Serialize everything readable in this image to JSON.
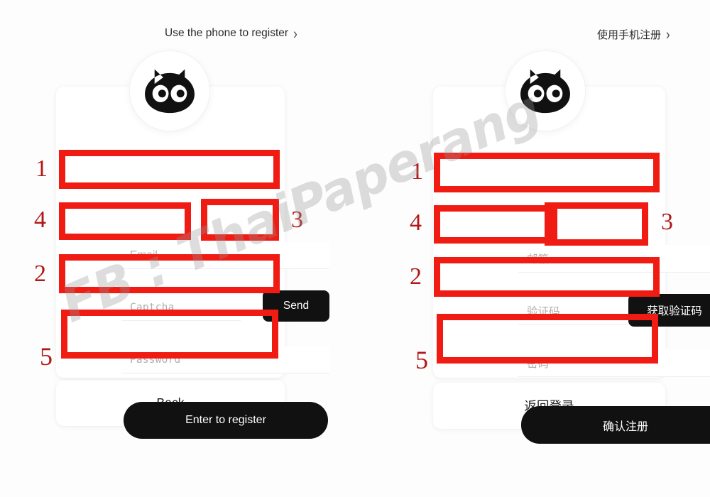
{
  "watermark": {
    "text": "FB : ThaiPaperang"
  },
  "panels": [
    {
      "id": "english",
      "top_link": {
        "label": "Use the phone to register",
        "chevron": "chevron-right-icon",
        "chevron_glyph": "›"
      },
      "logo": {
        "name": "cat-logo-icon"
      },
      "fields": {
        "email_placeholder": "Email",
        "captcha_placeholder": "Captcha",
        "password_placeholder": "Password"
      },
      "buttons": {
        "send_label": "Send",
        "submit_label": "Enter to register",
        "back_label": "Back"
      },
      "annotations": [
        {
          "number": "1",
          "target": "email-field"
        },
        {
          "number": "4",
          "target": "captcha-field"
        },
        {
          "number": "3",
          "target": "send-code-button"
        },
        {
          "number": "2",
          "target": "password-field"
        },
        {
          "number": "5",
          "target": "register-submit-button"
        }
      ]
    },
    {
      "id": "chinese",
      "top_link": {
        "label": "使用手机注册",
        "chevron": "chevron-right-icon",
        "chevron_glyph": "›"
      },
      "logo": {
        "name": "cat-logo-icon"
      },
      "fields": {
        "email_placeholder": "邮箱",
        "captcha_placeholder": "验证码",
        "password_placeholder": "密码"
      },
      "buttons": {
        "send_label": "获取验证码",
        "submit_label": "确认注册",
        "back_label": "返回登录"
      },
      "annotations": [
        {
          "number": "1",
          "target": "email-field"
        },
        {
          "number": "4",
          "target": "captcha-field"
        },
        {
          "number": "3",
          "target": "send-code-button"
        },
        {
          "number": "2",
          "target": "password-field"
        },
        {
          "number": "5",
          "target": "register-submit-button"
        }
      ]
    }
  ],
  "colors": {
    "annotation_red": "#f01b12",
    "annotation_number_red": "#b01818",
    "button_dark": "#111111",
    "placeholder_gray": "#aeaeae",
    "page_background": "#fdfdfd",
    "card_white": "#ffffff"
  }
}
